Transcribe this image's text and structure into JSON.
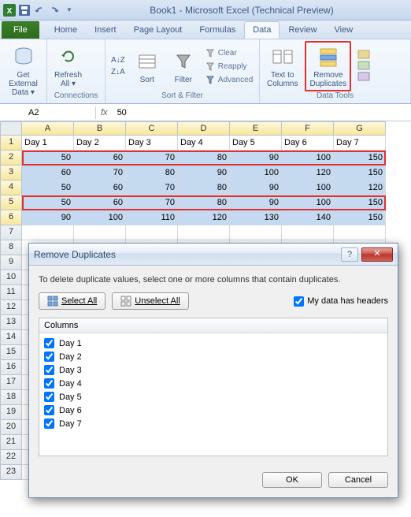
{
  "titlebar": {
    "title": "Book1 - Microsoft Excel (Technical Preview)"
  },
  "tabs": {
    "file": "File",
    "items": [
      "Home",
      "Insert",
      "Page Layout",
      "Formulas",
      "Data",
      "Review",
      "View"
    ],
    "active": "Data"
  },
  "ribbon": {
    "get_external": "Get External\nData ▾",
    "refresh": "Refresh\nAll ▾",
    "connections_label": "Connections",
    "sort_asc": "A↓Z",
    "sort_desc": "Z↓A",
    "sort": "Sort",
    "filter": "Filter",
    "clear": "Clear",
    "reapply": "Reapply",
    "advanced": "Advanced",
    "sortfilter_label": "Sort & Filter",
    "text_to_columns": "Text to\nColumns",
    "remove_duplicates": "Remove\nDuplicates",
    "datatools_label": "Data Tools"
  },
  "formula_bar": {
    "name": "A2",
    "fx": "fx",
    "value": "50"
  },
  "grid": {
    "cols": [
      "A",
      "B",
      "C",
      "D",
      "E",
      "F",
      "G"
    ],
    "headers": [
      "Day 1",
      "Day 2",
      "Day 3",
      "Day 4",
      "Day 5",
      "Day 6",
      "Day 7"
    ],
    "rows": [
      [
        "50",
        "60",
        "70",
        "80",
        "90",
        "100",
        "150"
      ],
      [
        "60",
        "70",
        "80",
        "90",
        "100",
        "120",
        "150"
      ],
      [
        "50",
        "60",
        "70",
        "80",
        "90",
        "100",
        "120"
      ],
      [
        "50",
        "60",
        "70",
        "80",
        "90",
        "100",
        "150"
      ],
      [
        "90",
        "100",
        "110",
        "120",
        "130",
        "140",
        "150"
      ]
    ]
  },
  "dialog": {
    "title": "Remove Duplicates",
    "message": "To delete duplicate values, select one or more columns that contain duplicates.",
    "select_all": "Select All",
    "unselect_all": "Unselect All",
    "headers_label": "My data has headers",
    "columns_header": "Columns",
    "columns": [
      "Day 1",
      "Day 2",
      "Day 3",
      "Day 4",
      "Day 5",
      "Day 6",
      "Day 7"
    ],
    "ok": "OK",
    "cancel": "Cancel"
  }
}
